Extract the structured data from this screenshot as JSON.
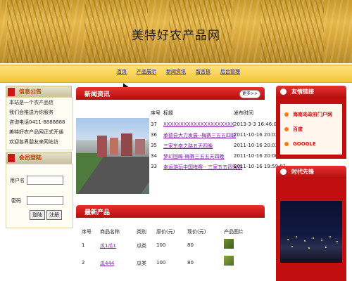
{
  "header": {
    "title": "美特好农产品网"
  },
  "nav": [
    "首页",
    "产品展示",
    "新闻资讯",
    "留言板",
    "后台管理"
  ],
  "notice": {
    "title": "信息公告",
    "lines": [
      "本站是一个农产品信",
      "我们会推送为你服务",
      "咨询电话0411-8888888",
      "美特好农产品网正式开通",
      "欢迎各界朋友来网站访"
    ]
  },
  "member": {
    "title": "会员登陆",
    "username_label": "用户名",
    "password_label": "密码",
    "login_button": "登陆",
    "register_button": "注册"
  },
  "news": {
    "title": "新闻资讯",
    "more": "更多>>",
    "columns": [
      "序号",
      "标题",
      "发布时间"
    ],
    "rows": [
      {
        "id": "37",
        "title": "XXXXXXXXXXXXXXXXXXXXX",
        "time": "2013-3-3 16:46:05"
      },
      {
        "id": "36",
        "title": "承德县大力发展--梅赛三五五四联",
        "time": "2011-10-16 20:03:55"
      },
      {
        "id": "35",
        "title": "三家东南之路五天四晚",
        "time": "2011-10-16 20:03:28"
      },
      {
        "id": "34",
        "title": "梦幻回眸-梅赛三五五天四晚",
        "time": "2011-10-16 20:00:26"
      },
      {
        "id": "33",
        "title": "幸运游玩中国梅赛-- 三家五五四晚游",
        "time": "2011-10-16 19:59:01"
      }
    ]
  },
  "products": {
    "title": "最新产品",
    "columns": [
      "序号",
      "商品名称",
      "类别",
      "原价(元)",
      "现价(元)",
      "产品图片"
    ],
    "rows": [
      {
        "id": "1",
        "name": "瓜1瓜1",
        "category": "瓜类",
        "original": "100",
        "current": "80"
      },
      {
        "id": "2",
        "name": "瓜444",
        "category": "瓜类",
        "original": "100",
        "current": "80"
      }
    ]
  },
  "friends": {
    "title": "友情链接",
    "links": [
      "海南岛政府门户网",
      "百度",
      "GOOGLE"
    ]
  },
  "era": {
    "title": "时代先锋"
  }
}
